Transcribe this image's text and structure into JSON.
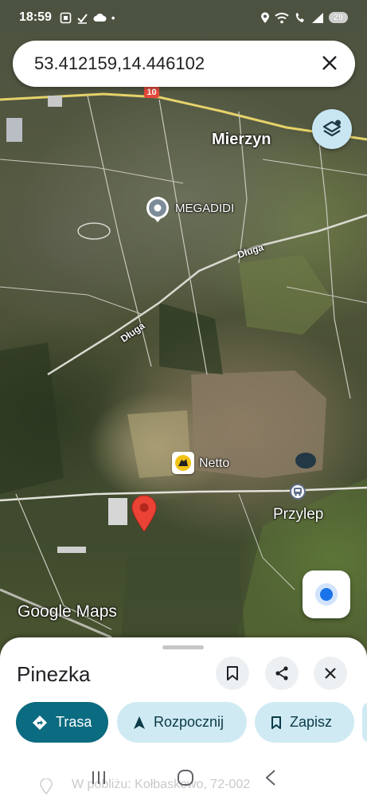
{
  "status_bar": {
    "time": "18:59",
    "battery": "29"
  },
  "search": {
    "query": "53.412159,14.446102"
  },
  "map": {
    "places": {
      "mierzyn": "Mierzyn",
      "megadidi": "MEGADIDI",
      "netto": "Netto",
      "przylep": "Przylep"
    },
    "streets": {
      "dluga_1": "Długa",
      "dluga_2": "Długa"
    },
    "road_shield": "10",
    "attribution": "Google Maps"
  },
  "sheet": {
    "title": "Pinezka",
    "actions": {
      "route": "Trasa",
      "start": "Rozpocznij",
      "save": "Zapisz"
    },
    "nearby": "W pobliżu: Kołbaskowo, 72-002"
  },
  "colors": {
    "primary_chip": "#0b6b80",
    "secondary_chip": "#cfeaf3",
    "pin_red": "#ea4335",
    "location_blue": "#1a73e8"
  }
}
